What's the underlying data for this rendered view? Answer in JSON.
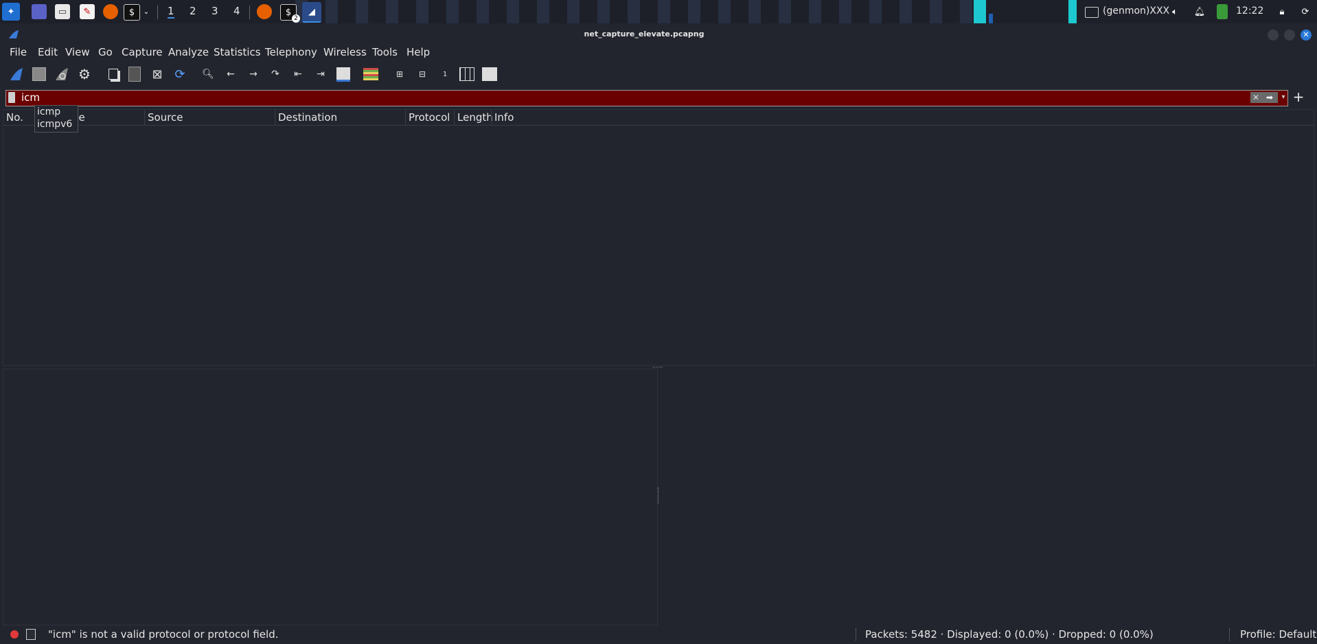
{
  "taskbar": {
    "workspaces": [
      "1",
      "2",
      "3",
      "4"
    ],
    "active_workspace": "1",
    "terminal_badge": "2",
    "genmon_label": "(genmon)XXX",
    "clock": "12:22"
  },
  "window": {
    "title": "net_capture_elevate.pcapng"
  },
  "menubar": {
    "items": [
      "File",
      "Edit",
      "View",
      "Go",
      "Capture",
      "Analyze",
      "Statistics",
      "Telephony",
      "Wireless",
      "Tools",
      "Help"
    ]
  },
  "toolbar": {
    "icons": [
      "shark-fin-start-icon",
      "stop-capture-icon",
      "restart-capture-icon",
      "capture-options-icon",
      "open-file-icon",
      "save-file-icon",
      "close-file-icon",
      "reload-icon",
      "find-icon",
      "go-back-icon",
      "go-forward-icon",
      "go-to-packet-icon",
      "first-packet-icon",
      "last-packet-icon",
      "autoscroll-icon",
      "colorize-icon",
      "zoom-in-icon",
      "zoom-out-icon",
      "normal-size-icon",
      "resize-columns-icon",
      "layout-icon"
    ]
  },
  "filter": {
    "value": "icm",
    "state_color": "#6b0000",
    "suggestions": [
      "icmp",
      "icmpv6"
    ]
  },
  "packet_list": {
    "columns": [
      "No.",
      "Time",
      "Source",
      "Destination",
      "Protocol",
      "Length",
      "Info"
    ]
  },
  "statusbar": {
    "message": "\"icm\" is not a valid protocol or protocol field.",
    "packets": "Packets: 5482 · Displayed: 0 (0.0%) · Dropped: 0 (0.0%)",
    "profile": "Profile: Default"
  },
  "colors": {
    "background": "#23252e",
    "invalid_filter": "#6b0000",
    "accent": "#3a8ee6"
  }
}
